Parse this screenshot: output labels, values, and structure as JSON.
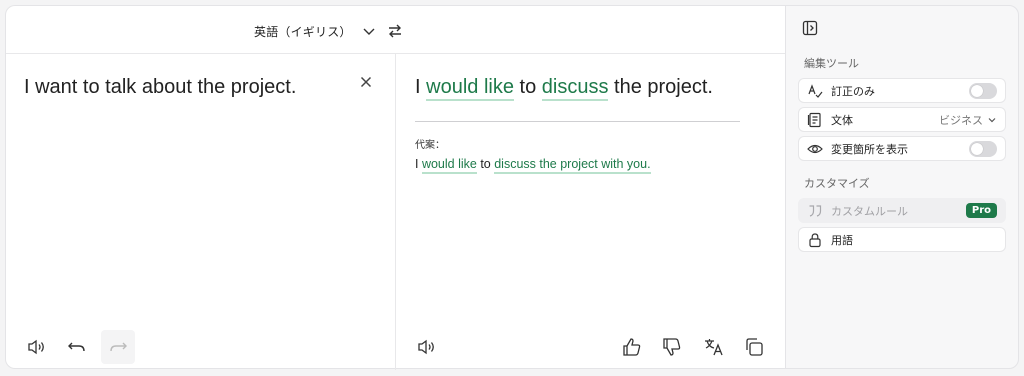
{
  "header": {
    "language": "英語（イギリス）"
  },
  "source": {
    "text": "I want to talk about the project."
  },
  "target": {
    "segments": [
      {
        "text": "I ",
        "highlight": false
      },
      {
        "text": "would like",
        "highlight": true
      },
      {
        "text": " to ",
        "highlight": false
      },
      {
        "text": "discuss",
        "highlight": true
      },
      {
        "text": " the project.",
        "highlight": false
      }
    ],
    "alt_label": "代案：",
    "alt_segments": [
      {
        "text": "I ",
        "highlight": false
      },
      {
        "text": "would like",
        "highlight": true
      },
      {
        "text": " to ",
        "highlight": false
      },
      {
        "text": "discuss the project with you.",
        "highlight": true
      }
    ]
  },
  "sidebar": {
    "edit_tools_title": "編集ツール",
    "corrections_only": "訂正のみ",
    "style_label": "文体",
    "style_value": "ビジネス",
    "show_changes": "変更箇所を表示",
    "customize_title": "カスタマイズ",
    "custom_rules": "カスタムルール",
    "pro_badge": "Pro",
    "glossary": "用語"
  },
  "colors": {
    "accent_green": "#1e7a4a",
    "highlight_underline": "#b9e1cc"
  }
}
